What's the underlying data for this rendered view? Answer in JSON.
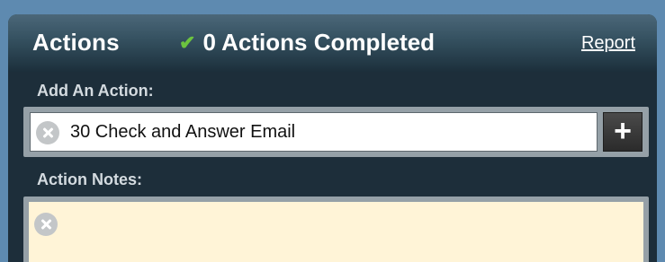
{
  "header": {
    "title": "Actions",
    "status_icon": "check-icon",
    "status_text": "0 Actions Completed",
    "report_link": "Report"
  },
  "add_action": {
    "label": "Add An Action:",
    "value": "30 Check and Answer Email",
    "add_button_label": "+"
  },
  "notes": {
    "label": "Action Notes:",
    "value": ""
  },
  "colors": {
    "check_green": "#6cc43f",
    "panel_dark": "#1d2e3a",
    "notes_background": "#fff4d7",
    "page_background": "#5e8ab0"
  }
}
